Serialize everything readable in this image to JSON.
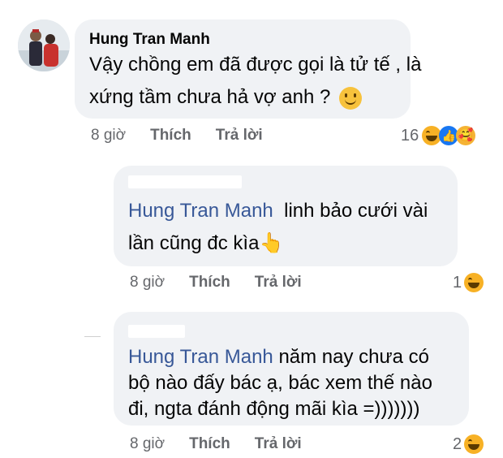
{
  "comment1": {
    "author": "Hung Tran Manh",
    "line1": "Vậy chồng em đã được gọi là tử tế , là",
    "line2": "xứng tầm chưa hả vợ anh ?",
    "time": "8 giờ",
    "like": "Thích",
    "reply": "Trả lời",
    "reaction_count": "16",
    "reaction_icons": [
      "haha-icon",
      "like-icon",
      "care-icon"
    ]
  },
  "reply1": {
    "mention": "Hung Tran Manh",
    "text_a": "linh bảo cưới vài",
    "text_b": "lần cũng đc kìa",
    "emoji": "👆",
    "time": "8 giờ",
    "like": "Thích",
    "reply": "Trả lời",
    "reaction_count": "1"
  },
  "reply2": {
    "mention": "Hung Tran Manh",
    "text_a": "năm nay chưa có",
    "text_b": "bộ nào đấy bác ạ, bác xem thế nào",
    "text_c": "đi, ngta đánh động mãi kìa =)))))))",
    "time": "8 giờ",
    "like": "Thích",
    "reply": "Trả lời",
    "reaction_count": "2"
  },
  "colors": {
    "bubble": "#f0f2f5",
    "mention": "#385898",
    "meta": "#65676b",
    "haha": "#f7b125",
    "like": "#1877f2"
  }
}
